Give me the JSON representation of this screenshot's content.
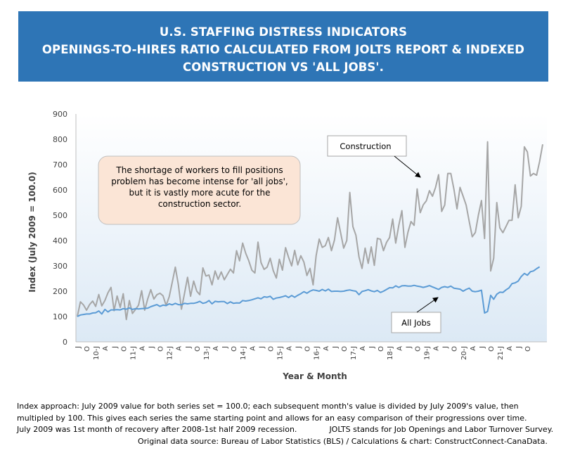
{
  "header": {
    "line1": "U.S. STAFFING DISTRESS INDICATORS",
    "line2": "OPENINGS-TO-HIRES RATIO CALCULATED FROM JOLTS REPORT & INDEXED",
    "line3": "CONSTRUCTION VS 'ALL JOBS'."
  },
  "colors": {
    "header_bg": "#2e75b6",
    "construction": "#a6a6a6",
    "all_jobs": "#5b9bd5",
    "callout_bg": "#fbe5d6",
    "plot_bg_bottom": "#dce9f5"
  },
  "chart_data": {
    "type": "line",
    "title": "",
    "xlabel": "Year & Month",
    "ylabel": "Index (July 2009 = 100.0)",
    "ylim": [
      0,
      900
    ],
    "yticks": [
      0,
      100,
      200,
      300,
      400,
      500,
      600,
      700,
      800,
      900
    ],
    "grid": false,
    "x_tick_labels": [
      "J",
      "O",
      "10-J",
      "A",
      "J",
      "O",
      "11-J",
      "A",
      "J",
      "O",
      "12-J",
      "A",
      "J",
      "O",
      "13-J",
      "A",
      "J",
      "O",
      "14-J",
      "A",
      "J",
      "O",
      "15-J",
      "A",
      "J",
      "O",
      "16-J",
      "A",
      "J",
      "O",
      "17-J",
      "A",
      "J",
      "O",
      "18-J",
      "A",
      "J",
      "O",
      "19-J",
      "A",
      "J",
      "O",
      "20-J",
      "A",
      "J",
      "O",
      "21-J",
      "A",
      "J",
      "O"
    ],
    "x_start": "2009-07",
    "x_end": "2021-10",
    "series": [
      {
        "name": "Construction",
        "values": [
          100,
          158,
          146,
          125,
          147,
          161,
          140,
          187,
          142,
          163,
          194,
          215,
          123,
          181,
          136,
          190,
          88,
          163,
          112,
          128,
          145,
          202,
          125,
          170,
          206,
          169,
          186,
          192,
          182,
          144,
          178,
          235,
          295,
          226,
          129,
          190,
          255,
          180,
          240,
          200,
          186,
          292,
          260,
          264,
          225,
          280,
          247,
          276,
          245,
          266,
          287,
          272,
          360,
          320,
          390,
          350,
          320,
          283,
          272,
          394,
          313,
          286,
          295,
          330,
          281,
          252,
          326,
          283,
          372,
          334,
          300,
          361,
          304,
          340,
          315,
          262,
          290,
          225,
          340,
          406,
          373,
          380,
          412,
          360,
          402,
          490,
          430,
          370,
          400,
          590,
          455,
          421,
          335,
          290,
          370,
          310,
          375,
          302,
          409,
          405,
          360,
          393,
          412,
          485,
          390,
          460,
          518,
          373,
          434,
          475,
          460,
          604,
          510,
          541,
          557,
          597,
          575,
          610,
          660,
          515,
          540,
          665,
          665,
          603,
          525,
          610,
          575,
          540,
          475,
          415,
          432,
          500,
          558,
          408,
          790,
          280,
          330,
          550,
          450,
          431,
          455,
          480,
          480,
          620,
          490,
          535,
          770,
          750,
          655,
          665,
          658,
          712,
          780
        ]
      },
      {
        "name": "All Jobs",
        "values": [
          100,
          106,
          108,
          110,
          110,
          114,
          115,
          122,
          110,
          128,
          118,
          126,
          126,
          127,
          126,
          131,
          129,
          134,
          128,
          131,
          130,
          131,
          132,
          133,
          139,
          143,
          147,
          140,
          145,
          143,
          150,
          146,
          152,
          147,
          146,
          152,
          150,
          152,
          152,
          155,
          160,
          152,
          155,
          163,
          150,
          160,
          158,
          159,
          159,
          151,
          158,
          152,
          154,
          153,
          163,
          161,
          163,
          166,
          170,
          174,
          170,
          178,
          176,
          180,
          168,
          173,
          175,
          178,
          182,
          175,
          183,
          176,
          184,
          190,
          198,
          192,
          200,
          205,
          203,
          200,
          207,
          201,
          208,
          199,
          200,
          200,
          199,
          200,
          203,
          205,
          202,
          200,
          186,
          199,
          202,
          206,
          201,
          198,
          203,
          195,
          200,
          207,
          214,
          213,
          221,
          215,
          221,
          222,
          220,
          220,
          223,
          220,
          218,
          215,
          218,
          222,
          217,
          212,
          207,
          215,
          218,
          215,
          220,
          212,
          210,
          208,
          200,
          207,
          212,
          200,
          198,
          200,
          204,
          114,
          120,
          184,
          168,
          188,
          196,
          195,
          205,
          213,
          230,
          233,
          240,
          258,
          270,
          263,
          277,
          280,
          289,
          296
        ]
      }
    ],
    "annotations": {
      "callout": "The shortage of workers to fill positions problem has become intense for 'all jobs', but it is vastly more acute for the construction sector.",
      "construction_label": "Construction",
      "all_jobs_label": "All Jobs"
    }
  },
  "footnote": {
    "line1": "Index approach: July 2009 value for both series set = 100.0; each subsequent month's value is divided by July 2009's value, then",
    "line2": "multipled by 100. This gives each series the same starting point and allows for an easy comparison of their progressions over time.",
    "line3a": "July 2009 was 1st month of recovery after 2008-1st half 2009 recession.",
    "line3b": "JOLTS stands for Job Openings and Labor Turnover Survey.",
    "line4": "Original data source: Bureau of Labor Statistics (BLS) / Calculations & chart: ConstructConnect-CanaData."
  }
}
